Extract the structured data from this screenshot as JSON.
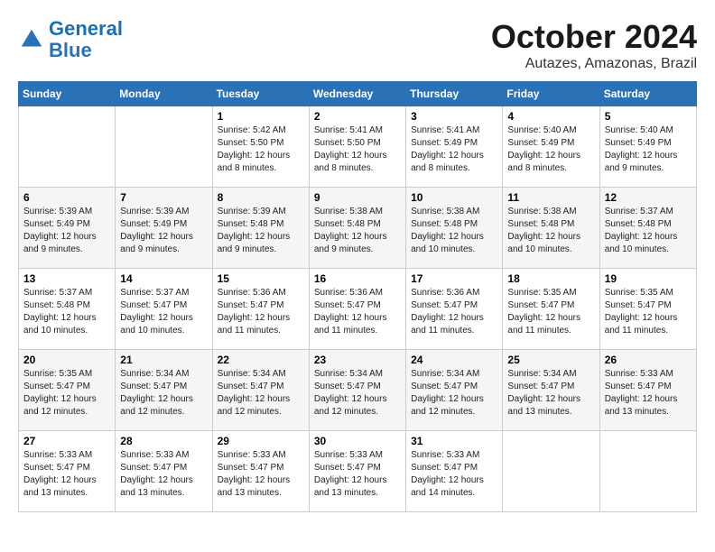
{
  "logo": {
    "line1": "General",
    "line2": "Blue"
  },
  "title": "October 2024",
  "location": "Autazes, Amazonas, Brazil",
  "weekdays": [
    "Sunday",
    "Monday",
    "Tuesday",
    "Wednesday",
    "Thursday",
    "Friday",
    "Saturday"
  ],
  "weeks": [
    [
      {
        "day": "",
        "sunrise": "",
        "sunset": "",
        "daylight": ""
      },
      {
        "day": "",
        "sunrise": "",
        "sunset": "",
        "daylight": ""
      },
      {
        "day": "1",
        "sunrise": "Sunrise: 5:42 AM",
        "sunset": "Sunset: 5:50 PM",
        "daylight": "Daylight: 12 hours and 8 minutes."
      },
      {
        "day": "2",
        "sunrise": "Sunrise: 5:41 AM",
        "sunset": "Sunset: 5:50 PM",
        "daylight": "Daylight: 12 hours and 8 minutes."
      },
      {
        "day": "3",
        "sunrise": "Sunrise: 5:41 AM",
        "sunset": "Sunset: 5:49 PM",
        "daylight": "Daylight: 12 hours and 8 minutes."
      },
      {
        "day": "4",
        "sunrise": "Sunrise: 5:40 AM",
        "sunset": "Sunset: 5:49 PM",
        "daylight": "Daylight: 12 hours and 8 minutes."
      },
      {
        "day": "5",
        "sunrise": "Sunrise: 5:40 AM",
        "sunset": "Sunset: 5:49 PM",
        "daylight": "Daylight: 12 hours and 9 minutes."
      }
    ],
    [
      {
        "day": "6",
        "sunrise": "Sunrise: 5:39 AM",
        "sunset": "Sunset: 5:49 PM",
        "daylight": "Daylight: 12 hours and 9 minutes."
      },
      {
        "day": "7",
        "sunrise": "Sunrise: 5:39 AM",
        "sunset": "Sunset: 5:49 PM",
        "daylight": "Daylight: 12 hours and 9 minutes."
      },
      {
        "day": "8",
        "sunrise": "Sunrise: 5:39 AM",
        "sunset": "Sunset: 5:48 PM",
        "daylight": "Daylight: 12 hours and 9 minutes."
      },
      {
        "day": "9",
        "sunrise": "Sunrise: 5:38 AM",
        "sunset": "Sunset: 5:48 PM",
        "daylight": "Daylight: 12 hours and 9 minutes."
      },
      {
        "day": "10",
        "sunrise": "Sunrise: 5:38 AM",
        "sunset": "Sunset: 5:48 PM",
        "daylight": "Daylight: 12 hours and 10 minutes."
      },
      {
        "day": "11",
        "sunrise": "Sunrise: 5:38 AM",
        "sunset": "Sunset: 5:48 PM",
        "daylight": "Daylight: 12 hours and 10 minutes."
      },
      {
        "day": "12",
        "sunrise": "Sunrise: 5:37 AM",
        "sunset": "Sunset: 5:48 PM",
        "daylight": "Daylight: 12 hours and 10 minutes."
      }
    ],
    [
      {
        "day": "13",
        "sunrise": "Sunrise: 5:37 AM",
        "sunset": "Sunset: 5:48 PM",
        "daylight": "Daylight: 12 hours and 10 minutes."
      },
      {
        "day": "14",
        "sunrise": "Sunrise: 5:37 AM",
        "sunset": "Sunset: 5:47 PM",
        "daylight": "Daylight: 12 hours and 10 minutes."
      },
      {
        "day": "15",
        "sunrise": "Sunrise: 5:36 AM",
        "sunset": "Sunset: 5:47 PM",
        "daylight": "Daylight: 12 hours and 11 minutes."
      },
      {
        "day": "16",
        "sunrise": "Sunrise: 5:36 AM",
        "sunset": "Sunset: 5:47 PM",
        "daylight": "Daylight: 12 hours and 11 minutes."
      },
      {
        "day": "17",
        "sunrise": "Sunrise: 5:36 AM",
        "sunset": "Sunset: 5:47 PM",
        "daylight": "Daylight: 12 hours and 11 minutes."
      },
      {
        "day": "18",
        "sunrise": "Sunrise: 5:35 AM",
        "sunset": "Sunset: 5:47 PM",
        "daylight": "Daylight: 12 hours and 11 minutes."
      },
      {
        "day": "19",
        "sunrise": "Sunrise: 5:35 AM",
        "sunset": "Sunset: 5:47 PM",
        "daylight": "Daylight: 12 hours and 11 minutes."
      }
    ],
    [
      {
        "day": "20",
        "sunrise": "Sunrise: 5:35 AM",
        "sunset": "Sunset: 5:47 PM",
        "daylight": "Daylight: 12 hours and 12 minutes."
      },
      {
        "day": "21",
        "sunrise": "Sunrise: 5:34 AM",
        "sunset": "Sunset: 5:47 PM",
        "daylight": "Daylight: 12 hours and 12 minutes."
      },
      {
        "day": "22",
        "sunrise": "Sunrise: 5:34 AM",
        "sunset": "Sunset: 5:47 PM",
        "daylight": "Daylight: 12 hours and 12 minutes."
      },
      {
        "day": "23",
        "sunrise": "Sunrise: 5:34 AM",
        "sunset": "Sunset: 5:47 PM",
        "daylight": "Daylight: 12 hours and 12 minutes."
      },
      {
        "day": "24",
        "sunrise": "Sunrise: 5:34 AM",
        "sunset": "Sunset: 5:47 PM",
        "daylight": "Daylight: 12 hours and 12 minutes."
      },
      {
        "day": "25",
        "sunrise": "Sunrise: 5:34 AM",
        "sunset": "Sunset: 5:47 PM",
        "daylight": "Daylight: 12 hours and 13 minutes."
      },
      {
        "day": "26",
        "sunrise": "Sunrise: 5:33 AM",
        "sunset": "Sunset: 5:47 PM",
        "daylight": "Daylight: 12 hours and 13 minutes."
      }
    ],
    [
      {
        "day": "27",
        "sunrise": "Sunrise: 5:33 AM",
        "sunset": "Sunset: 5:47 PM",
        "daylight": "Daylight: 12 hours and 13 minutes."
      },
      {
        "day": "28",
        "sunrise": "Sunrise: 5:33 AM",
        "sunset": "Sunset: 5:47 PM",
        "daylight": "Daylight: 12 hours and 13 minutes."
      },
      {
        "day": "29",
        "sunrise": "Sunrise: 5:33 AM",
        "sunset": "Sunset: 5:47 PM",
        "daylight": "Daylight: 12 hours and 13 minutes."
      },
      {
        "day": "30",
        "sunrise": "Sunrise: 5:33 AM",
        "sunset": "Sunset: 5:47 PM",
        "daylight": "Daylight: 12 hours and 13 minutes."
      },
      {
        "day": "31",
        "sunrise": "Sunrise: 5:33 AM",
        "sunset": "Sunset: 5:47 PM",
        "daylight": "Daylight: 12 hours and 14 minutes."
      },
      {
        "day": "",
        "sunrise": "",
        "sunset": "",
        "daylight": ""
      },
      {
        "day": "",
        "sunrise": "",
        "sunset": "",
        "daylight": ""
      }
    ]
  ]
}
